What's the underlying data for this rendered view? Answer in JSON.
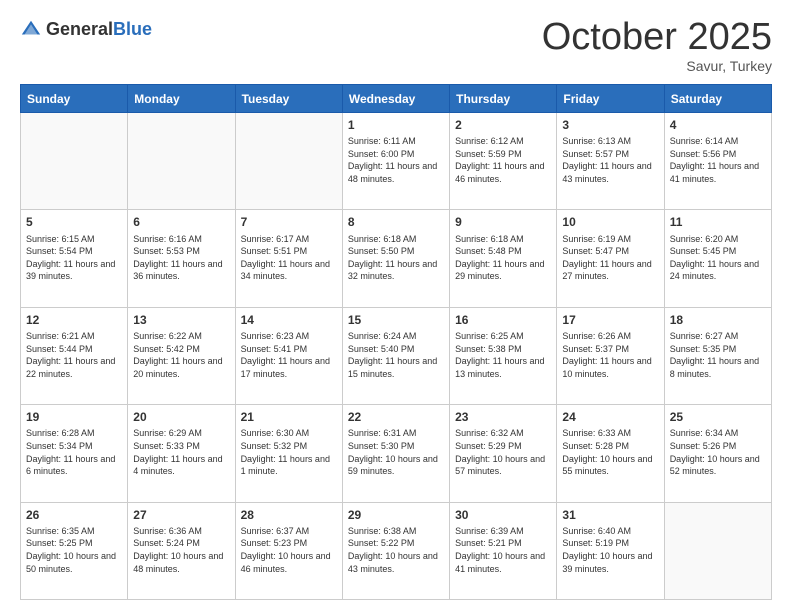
{
  "header": {
    "logo_general": "General",
    "logo_blue": "Blue",
    "month_title": "October 2025",
    "subtitle": "Savur, Turkey"
  },
  "columns": [
    "Sunday",
    "Monday",
    "Tuesday",
    "Wednesday",
    "Thursday",
    "Friday",
    "Saturday"
  ],
  "weeks": [
    [
      {
        "day": "",
        "info": ""
      },
      {
        "day": "",
        "info": ""
      },
      {
        "day": "",
        "info": ""
      },
      {
        "day": "1",
        "info": "Sunrise: 6:11 AM\nSunset: 6:00 PM\nDaylight: 11 hours and 48 minutes."
      },
      {
        "day": "2",
        "info": "Sunrise: 6:12 AM\nSunset: 5:59 PM\nDaylight: 11 hours and 46 minutes."
      },
      {
        "day": "3",
        "info": "Sunrise: 6:13 AM\nSunset: 5:57 PM\nDaylight: 11 hours and 43 minutes."
      },
      {
        "day": "4",
        "info": "Sunrise: 6:14 AM\nSunset: 5:56 PM\nDaylight: 11 hours and 41 minutes."
      }
    ],
    [
      {
        "day": "5",
        "info": "Sunrise: 6:15 AM\nSunset: 5:54 PM\nDaylight: 11 hours and 39 minutes."
      },
      {
        "day": "6",
        "info": "Sunrise: 6:16 AM\nSunset: 5:53 PM\nDaylight: 11 hours and 36 minutes."
      },
      {
        "day": "7",
        "info": "Sunrise: 6:17 AM\nSunset: 5:51 PM\nDaylight: 11 hours and 34 minutes."
      },
      {
        "day": "8",
        "info": "Sunrise: 6:18 AM\nSunset: 5:50 PM\nDaylight: 11 hours and 32 minutes."
      },
      {
        "day": "9",
        "info": "Sunrise: 6:18 AM\nSunset: 5:48 PM\nDaylight: 11 hours and 29 minutes."
      },
      {
        "day": "10",
        "info": "Sunrise: 6:19 AM\nSunset: 5:47 PM\nDaylight: 11 hours and 27 minutes."
      },
      {
        "day": "11",
        "info": "Sunrise: 6:20 AM\nSunset: 5:45 PM\nDaylight: 11 hours and 24 minutes."
      }
    ],
    [
      {
        "day": "12",
        "info": "Sunrise: 6:21 AM\nSunset: 5:44 PM\nDaylight: 11 hours and 22 minutes."
      },
      {
        "day": "13",
        "info": "Sunrise: 6:22 AM\nSunset: 5:42 PM\nDaylight: 11 hours and 20 minutes."
      },
      {
        "day": "14",
        "info": "Sunrise: 6:23 AM\nSunset: 5:41 PM\nDaylight: 11 hours and 17 minutes."
      },
      {
        "day": "15",
        "info": "Sunrise: 6:24 AM\nSunset: 5:40 PM\nDaylight: 11 hours and 15 minutes."
      },
      {
        "day": "16",
        "info": "Sunrise: 6:25 AM\nSunset: 5:38 PM\nDaylight: 11 hours and 13 minutes."
      },
      {
        "day": "17",
        "info": "Sunrise: 6:26 AM\nSunset: 5:37 PM\nDaylight: 11 hours and 10 minutes."
      },
      {
        "day": "18",
        "info": "Sunrise: 6:27 AM\nSunset: 5:35 PM\nDaylight: 11 hours and 8 minutes."
      }
    ],
    [
      {
        "day": "19",
        "info": "Sunrise: 6:28 AM\nSunset: 5:34 PM\nDaylight: 11 hours and 6 minutes."
      },
      {
        "day": "20",
        "info": "Sunrise: 6:29 AM\nSunset: 5:33 PM\nDaylight: 11 hours and 4 minutes."
      },
      {
        "day": "21",
        "info": "Sunrise: 6:30 AM\nSunset: 5:32 PM\nDaylight: 11 hours and 1 minute."
      },
      {
        "day": "22",
        "info": "Sunrise: 6:31 AM\nSunset: 5:30 PM\nDaylight: 10 hours and 59 minutes."
      },
      {
        "day": "23",
        "info": "Sunrise: 6:32 AM\nSunset: 5:29 PM\nDaylight: 10 hours and 57 minutes."
      },
      {
        "day": "24",
        "info": "Sunrise: 6:33 AM\nSunset: 5:28 PM\nDaylight: 10 hours and 55 minutes."
      },
      {
        "day": "25",
        "info": "Sunrise: 6:34 AM\nSunset: 5:26 PM\nDaylight: 10 hours and 52 minutes."
      }
    ],
    [
      {
        "day": "26",
        "info": "Sunrise: 6:35 AM\nSunset: 5:25 PM\nDaylight: 10 hours and 50 minutes."
      },
      {
        "day": "27",
        "info": "Sunrise: 6:36 AM\nSunset: 5:24 PM\nDaylight: 10 hours and 48 minutes."
      },
      {
        "day": "28",
        "info": "Sunrise: 6:37 AM\nSunset: 5:23 PM\nDaylight: 10 hours and 46 minutes."
      },
      {
        "day": "29",
        "info": "Sunrise: 6:38 AM\nSunset: 5:22 PM\nDaylight: 10 hours and 43 minutes."
      },
      {
        "day": "30",
        "info": "Sunrise: 6:39 AM\nSunset: 5:21 PM\nDaylight: 10 hours and 41 minutes."
      },
      {
        "day": "31",
        "info": "Sunrise: 6:40 AM\nSunset: 5:19 PM\nDaylight: 10 hours and 39 minutes."
      },
      {
        "day": "",
        "info": ""
      }
    ]
  ]
}
